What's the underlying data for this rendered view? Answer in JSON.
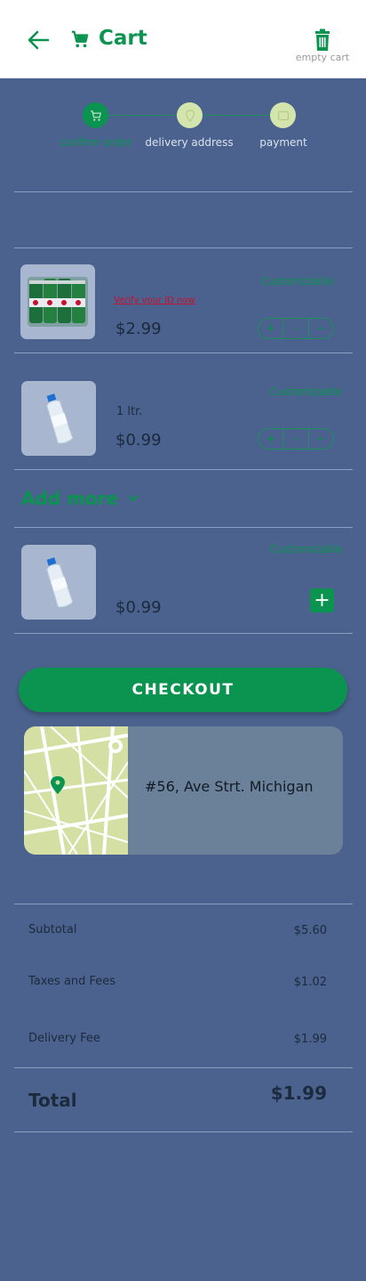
{
  "header": {
    "title": "Cart",
    "empty_cart_label": "empty cart"
  },
  "stepper": {
    "steps": [
      {
        "label": "confirm order",
        "icon": "cart-icon",
        "active": true
      },
      {
        "label": "delivery address",
        "icon": "location-pin-icon",
        "active": false
      },
      {
        "label": "payment",
        "icon": "card-icon",
        "active": false
      }
    ]
  },
  "items": [
    {
      "name": "beer-six-pack",
      "verify_text": "Verify your ID now",
      "price": "$2.99",
      "customizable_label": "Customizable",
      "qty_plus": "+",
      "qty_value": "-",
      "qty_minus": "−"
    },
    {
      "name": "water-bottle",
      "unit": "1 ltr.",
      "price": "$0.99",
      "customizable_label": "Customizable",
      "qty_plus": "+",
      "qty_value": "-",
      "qty_minus": "−"
    }
  ],
  "add_more": {
    "label": "Add more",
    "items": [
      {
        "name": "water-bottle",
        "price": "$0.99",
        "customizable_label": "Customizable",
        "add_label": "+"
      }
    ]
  },
  "checkout_label": "CHECKOUT",
  "address": {
    "text": "#56, Ave Strt. Michigan"
  },
  "summary": {
    "subtotal_label": "Subtotal",
    "subtotal_value": "$5.60",
    "taxes_label": "Taxes and Fees",
    "taxes_value": "$1.02",
    "delivery_label": "Delivery Fee",
    "delivery_value": "$1.99",
    "total_label": "Total",
    "total_value": "$1.99"
  },
  "colors": {
    "accent": "#0b9450",
    "background": "#4a628d",
    "step_inactive": "#d3e5ad",
    "warning": "#c8102e"
  }
}
